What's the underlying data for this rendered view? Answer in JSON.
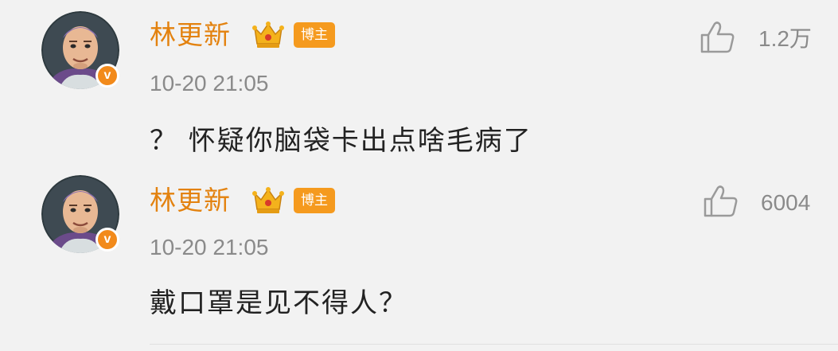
{
  "comments": [
    {
      "username": "林更新",
      "badge": "博主",
      "verified_mark": "v",
      "timestamp": "10-20 21:05",
      "text": "？ 怀疑你脑袋卡出点啥毛病了",
      "likes": "1.2万"
    },
    {
      "username": "林更新",
      "badge": "博主",
      "verified_mark": "v",
      "timestamp": "10-20 21:05",
      "text": "戴口罩是见不得人？",
      "likes": "6004"
    }
  ],
  "icons": {
    "avatar": "buzz-lightyear-avatar",
    "verified": "verified-v-icon",
    "crown": "crown-icon",
    "like": "thumbs-up-icon"
  },
  "colors": {
    "background": "#f2f2f2",
    "username": "#e3820f",
    "badge": "#f59a1e",
    "timestamp": "#8a8a8a",
    "text": "#222222"
  }
}
